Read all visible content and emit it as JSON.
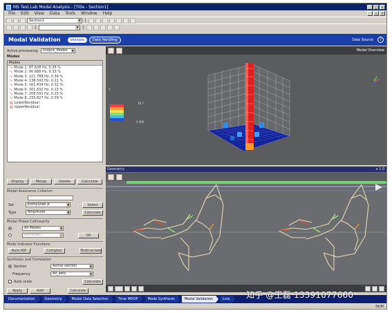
{
  "window": {
    "title": "MS Test.Lab Modal Analysis - [Title - Section1]"
  },
  "menu": [
    "File",
    "Edit",
    "View",
    "Data",
    "Tools",
    "Window",
    "Help"
  ],
  "toolbar": {
    "combo_value": "Section1"
  },
  "header": {
    "title": "Modal Validation",
    "tabs": [
      "Validate",
      "Data Handling"
    ],
    "right_label": "Data Source",
    "sub_right": "Modal Overview"
  },
  "left": {
    "processing_label": "Active processing:",
    "processing_value": "Output_Modes",
    "modes_label": "Modes",
    "list_header": "Modes",
    "modes": [
      "Mode 1: 87.628 Hz, 0.35 %",
      "Mode 2: 90.688 Hz, 0.33 %",
      "Mode 3: 121.788 Hz, 0.34 %",
      "Mode 4: 138.592 Hz, 0.21 %",
      "Mode 5: 161.434 Hz, 0.32 %",
      "Mode 6: 201.632 Hz, 0.13 %",
      "Mode 7: 208.591 Hz, 0.25 %",
      "Mode 8: 235.827 Hz, 0.39 %",
      "LowerResidual",
      "UpperResidual"
    ],
    "list_buttons": [
      "Display",
      "Merge",
      "Delete",
      "Calculate"
    ],
    "sec1_title": "Modal Assurance Criterion",
    "sec1_row1_label": "Set",
    "sec1_row1_value": "EntityShell A",
    "sec1_row1_btn": "Select",
    "sec1_row2_label": "Type",
    "sec1_row2_value": "Amplitude",
    "sec1_row2_btn": "Calculate",
    "sec2_title": "Modal Phase Collinearity",
    "sec2_row1_value": "All Modes",
    "sec2_row2_value": "Residuals",
    "sec2_btn": "OK",
    "sec3_title": "Mode Indicator Functions",
    "sec3_buttons": [
      "Auto MIF",
      "Complex",
      "Multivariate"
    ],
    "sec4_title": "Synthesis and Correlation",
    "sec4_row1_label": "Section",
    "sec4_row1_value": "Active section",
    "sec4_row2_label": "Frequency",
    "sec4_row2_value": "All_sets",
    "sec4_row3_label": "Auto scale",
    "sec4_row3_btn": "Calculate",
    "bottom_buttons": [
      "Apply",
      "Add",
      "Calculate"
    ]
  },
  "view3d": {
    "legend_value_top": "38.7",
    "legend_value_bottom": "0.000",
    "axis_label": "1"
  },
  "viewbot": {
    "title": "Geometry",
    "right_label": "x 1.0"
  },
  "workflow": {
    "steps": [
      "Documentation",
      "Geometry",
      "Modal Data Selection",
      "Time MDOF",
      "Mode Synthesis",
      "Modal Validation",
      "Lms"
    ],
    "active_index": 5
  },
  "statusbar": {
    "caps": "NUM"
  },
  "watermark": "知乎 @王磊 13391077660"
}
